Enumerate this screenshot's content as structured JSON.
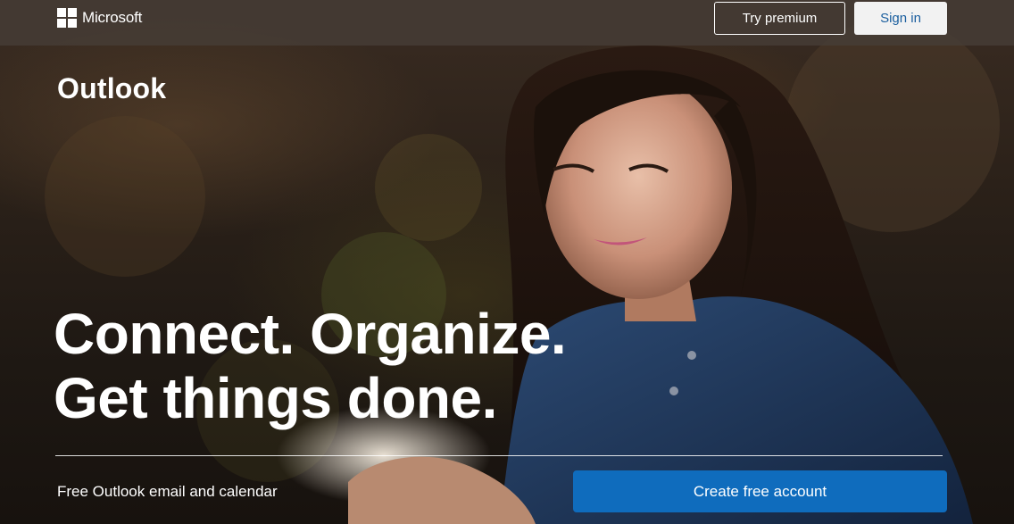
{
  "header": {
    "brand": "Microsoft",
    "try_premium_label": "Try premium",
    "sign_in_label": "Sign in"
  },
  "hero": {
    "product_name": "Outlook",
    "headline_line1": "Connect. Organize.",
    "headline_line2": "Get things done.",
    "tagline": "Free Outlook email and calendar",
    "cta_label": "Create free account"
  },
  "colors": {
    "cta_blue": "#0f6cbd",
    "sign_in_text": "#1a5e9e",
    "topbar_bg": "#463e37"
  },
  "icons": {
    "brand_logo": "microsoft-logo-icon"
  }
}
